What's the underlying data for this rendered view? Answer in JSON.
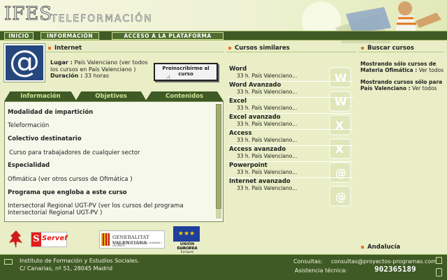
{
  "header": {
    "logo_main": "IFES",
    "logo_sub": "TELEFORMACIÓN"
  },
  "nav": [
    "INICIO",
    "INFORMACIÓN",
    "ACCESO A LA PLATAFORMA"
  ],
  "course": {
    "title": "Internet",
    "lugar_label": "Lugar :",
    "lugar_value": " País Valenciano (ver todos los cursos en País Valenciano )",
    "duracion_label": "Duración :",
    "duracion_value": " 33 horas",
    "enroll_label": "Preinscribirme al curso"
  },
  "tabs": [
    "Información",
    "Objetivos",
    "Contenidos"
  ],
  "info": {
    "modalidad_heading": "Modalidad de impartición",
    "modalidad_value": "Teleformación",
    "colectivo_heading": "Colectivo destinatario",
    "colectivo_value": "Curso para trabajadores de cualquier sector",
    "especialidad_heading": "Especialidad",
    "especialidad_value": "Ofimática (ver otros cursos de Ofimática )",
    "programa_heading": "Programa que engloba a este curso",
    "programa_value": "Intersectoral Regional UGT-PV (ver los cursos del programa Intersectorial Regional UGT-PV )"
  },
  "logos": {
    "servef": "Servef",
    "generalitat": "GENERALITAT VALENCIANA",
    "generalitat_sub": "CONSELLERIA DE ECONOMÍA, HISENDA I OCUPACIÓ",
    "ue": "UNIÓN EUROPEA",
    "ue_sub": "Fondo Social Europeo"
  },
  "similares": {
    "title": "Cursos similares",
    "items": [
      {
        "name": "Word",
        "meta": "33 h. País Valenciano..."
      },
      {
        "name": "Word Avanzado",
        "meta": "33 h. País Valenciano..."
      },
      {
        "name": "Excel",
        "meta": "33 h. País Valenciano..."
      },
      {
        "name": "Excel avanzado",
        "meta": "33 h. País Valenciano..."
      },
      {
        "name": "Access",
        "meta": "33 h. País Valenciano..."
      },
      {
        "name": "Access avanzado",
        "meta": "33 h. País Valenciano..."
      },
      {
        "name": "Powerpoint",
        "meta": "33 h. País Valenciano..."
      },
      {
        "name": "Internet avanzado",
        "meta": "33 h. País Valenciano..."
      }
    ]
  },
  "buscar": {
    "title": "Buscar cursos",
    "line1_bold": "Mostrando sólo cursos de Materia Ofimática :",
    "line1_link": " Ver todos",
    "line2_bold": "Mostrando cursos sólo para País Valenciano :",
    "line2_link": " Ver todos",
    "region": "Andalucía"
  },
  "footer": {
    "address1": "Instituto de Formación y Estudios Sociales.",
    "address2": "C/ Canarias, nº 51, 28045 Madrid",
    "consultas_label": "Consultas:",
    "consultas_email": "consultas@proyectos-programas.com",
    "asistencia_label": "Asistencia técnica:",
    "asistencia_phone": "902365189"
  },
  "colors": {
    "dark_green": "#3f5a25",
    "accent_orange": "#e2781e",
    "navy": "#26477e"
  }
}
